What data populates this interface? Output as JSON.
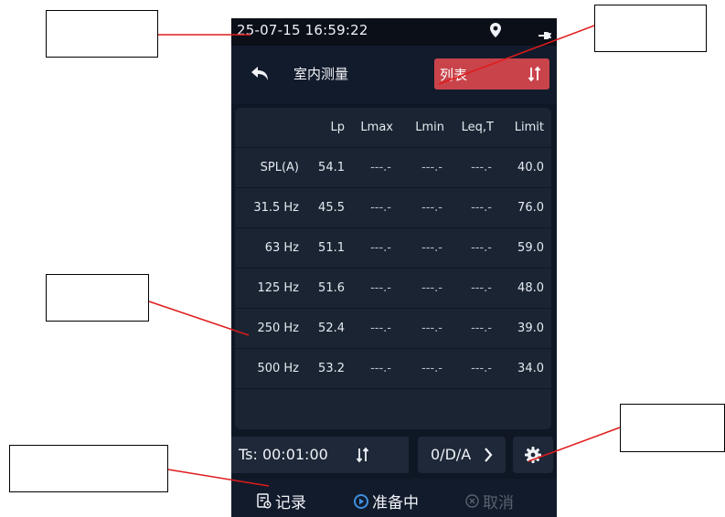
{
  "status": {
    "datetime": "25-07-15 16:59:22",
    "location_icon": "location-pin-icon",
    "battery_icon": "charging-plug-icon"
  },
  "header": {
    "back_icon": "back-arrow-icon",
    "title": "室内测量",
    "view_label": "列表",
    "sort_icon": "sort-arrows-icon"
  },
  "table": {
    "columns": [
      "",
      "Lp",
      "Lmax",
      "Lmin",
      "Leq,T",
      "Limit"
    ],
    "rows": [
      {
        "label": "SPL(A)",
        "lp": "54.1",
        "lmax": "---.-",
        "lmin": "---.-",
        "leq": "---.-",
        "limit": "40.0"
      },
      {
        "label": "31.5 Hz",
        "lp": "45.5",
        "lmax": "---.-",
        "lmin": "---.-",
        "leq": "---.-",
        "limit": "76.0"
      },
      {
        "label": "63 Hz",
        "lp": "51.1",
        "lmax": "---.-",
        "lmin": "---.-",
        "leq": "---.-",
        "limit": "59.0"
      },
      {
        "label": "125 Hz",
        "lp": "51.6",
        "lmax": "---.-",
        "lmin": "---.-",
        "leq": "---.-",
        "limit": "48.0"
      },
      {
        "label": "250 Hz",
        "lp": "52.4",
        "lmax": "---.-",
        "lmin": "---.-",
        "leq": "---.-",
        "limit": "39.0"
      },
      {
        "label": "500 Hz",
        "lp": "53.2",
        "lmax": "---.-",
        "lmin": "---.-",
        "leq": "---.-",
        "limit": "34.0"
      }
    ]
  },
  "bottom": {
    "ts_label": "Ts: 00:01:00",
    "mode_label": "0/D/A",
    "gear_icon": "gear-icon"
  },
  "actions": {
    "record_label": "记录",
    "status_label": "准备中",
    "cancel_label": "取消"
  },
  "colors": {
    "accent_red": "#c9434b",
    "background": "#0f1725",
    "panel": "#1a2433",
    "status_blue": "#3f8fe0",
    "disabled": "#59616e"
  }
}
